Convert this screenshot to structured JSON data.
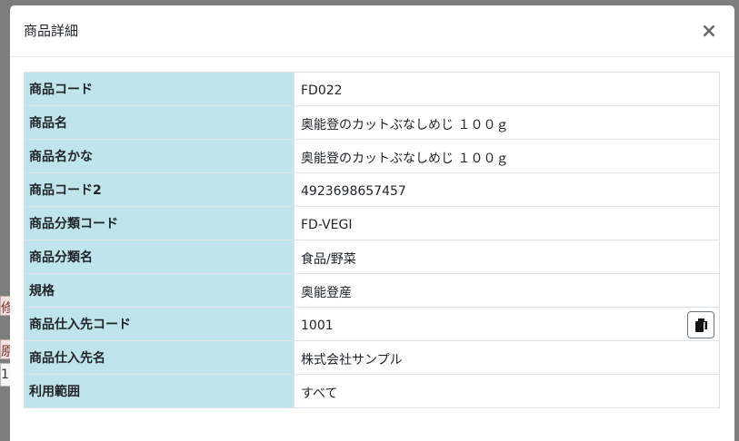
{
  "modal": {
    "title": "商品詳細",
    "close_icon": "close-icon",
    "close_glyph": "×"
  },
  "rows": [
    {
      "label": "商品コード",
      "value": "FD022"
    },
    {
      "label": "商品名",
      "value": "奥能登のカットぶなしめじ １００ｇ"
    },
    {
      "label": "商品名かな",
      "value": "奥能登のカットぶなしめじ １００ｇ"
    },
    {
      "label": "商品コード2",
      "value": "4923698657457"
    },
    {
      "label": "商品分類コード",
      "value": "FD-VEGI"
    },
    {
      "label": "商品分類名",
      "value": "食品/野菜"
    },
    {
      "label": "規格",
      "value": "奥能登産"
    },
    {
      "label": "商品仕入先コード",
      "value": "1001",
      "action_icon": "copy-icon"
    },
    {
      "label": "商品仕入先名",
      "value": "株式会社サンプル"
    },
    {
      "label": "利用範囲",
      "value": "すべて"
    }
  ],
  "background": {
    "fragments": [
      "修",
      "原",
      "1"
    ]
  },
  "colors": {
    "label_bg": "#bfe4ec",
    "border": "#dee2e6",
    "backdrop": "#7d7d7d"
  }
}
